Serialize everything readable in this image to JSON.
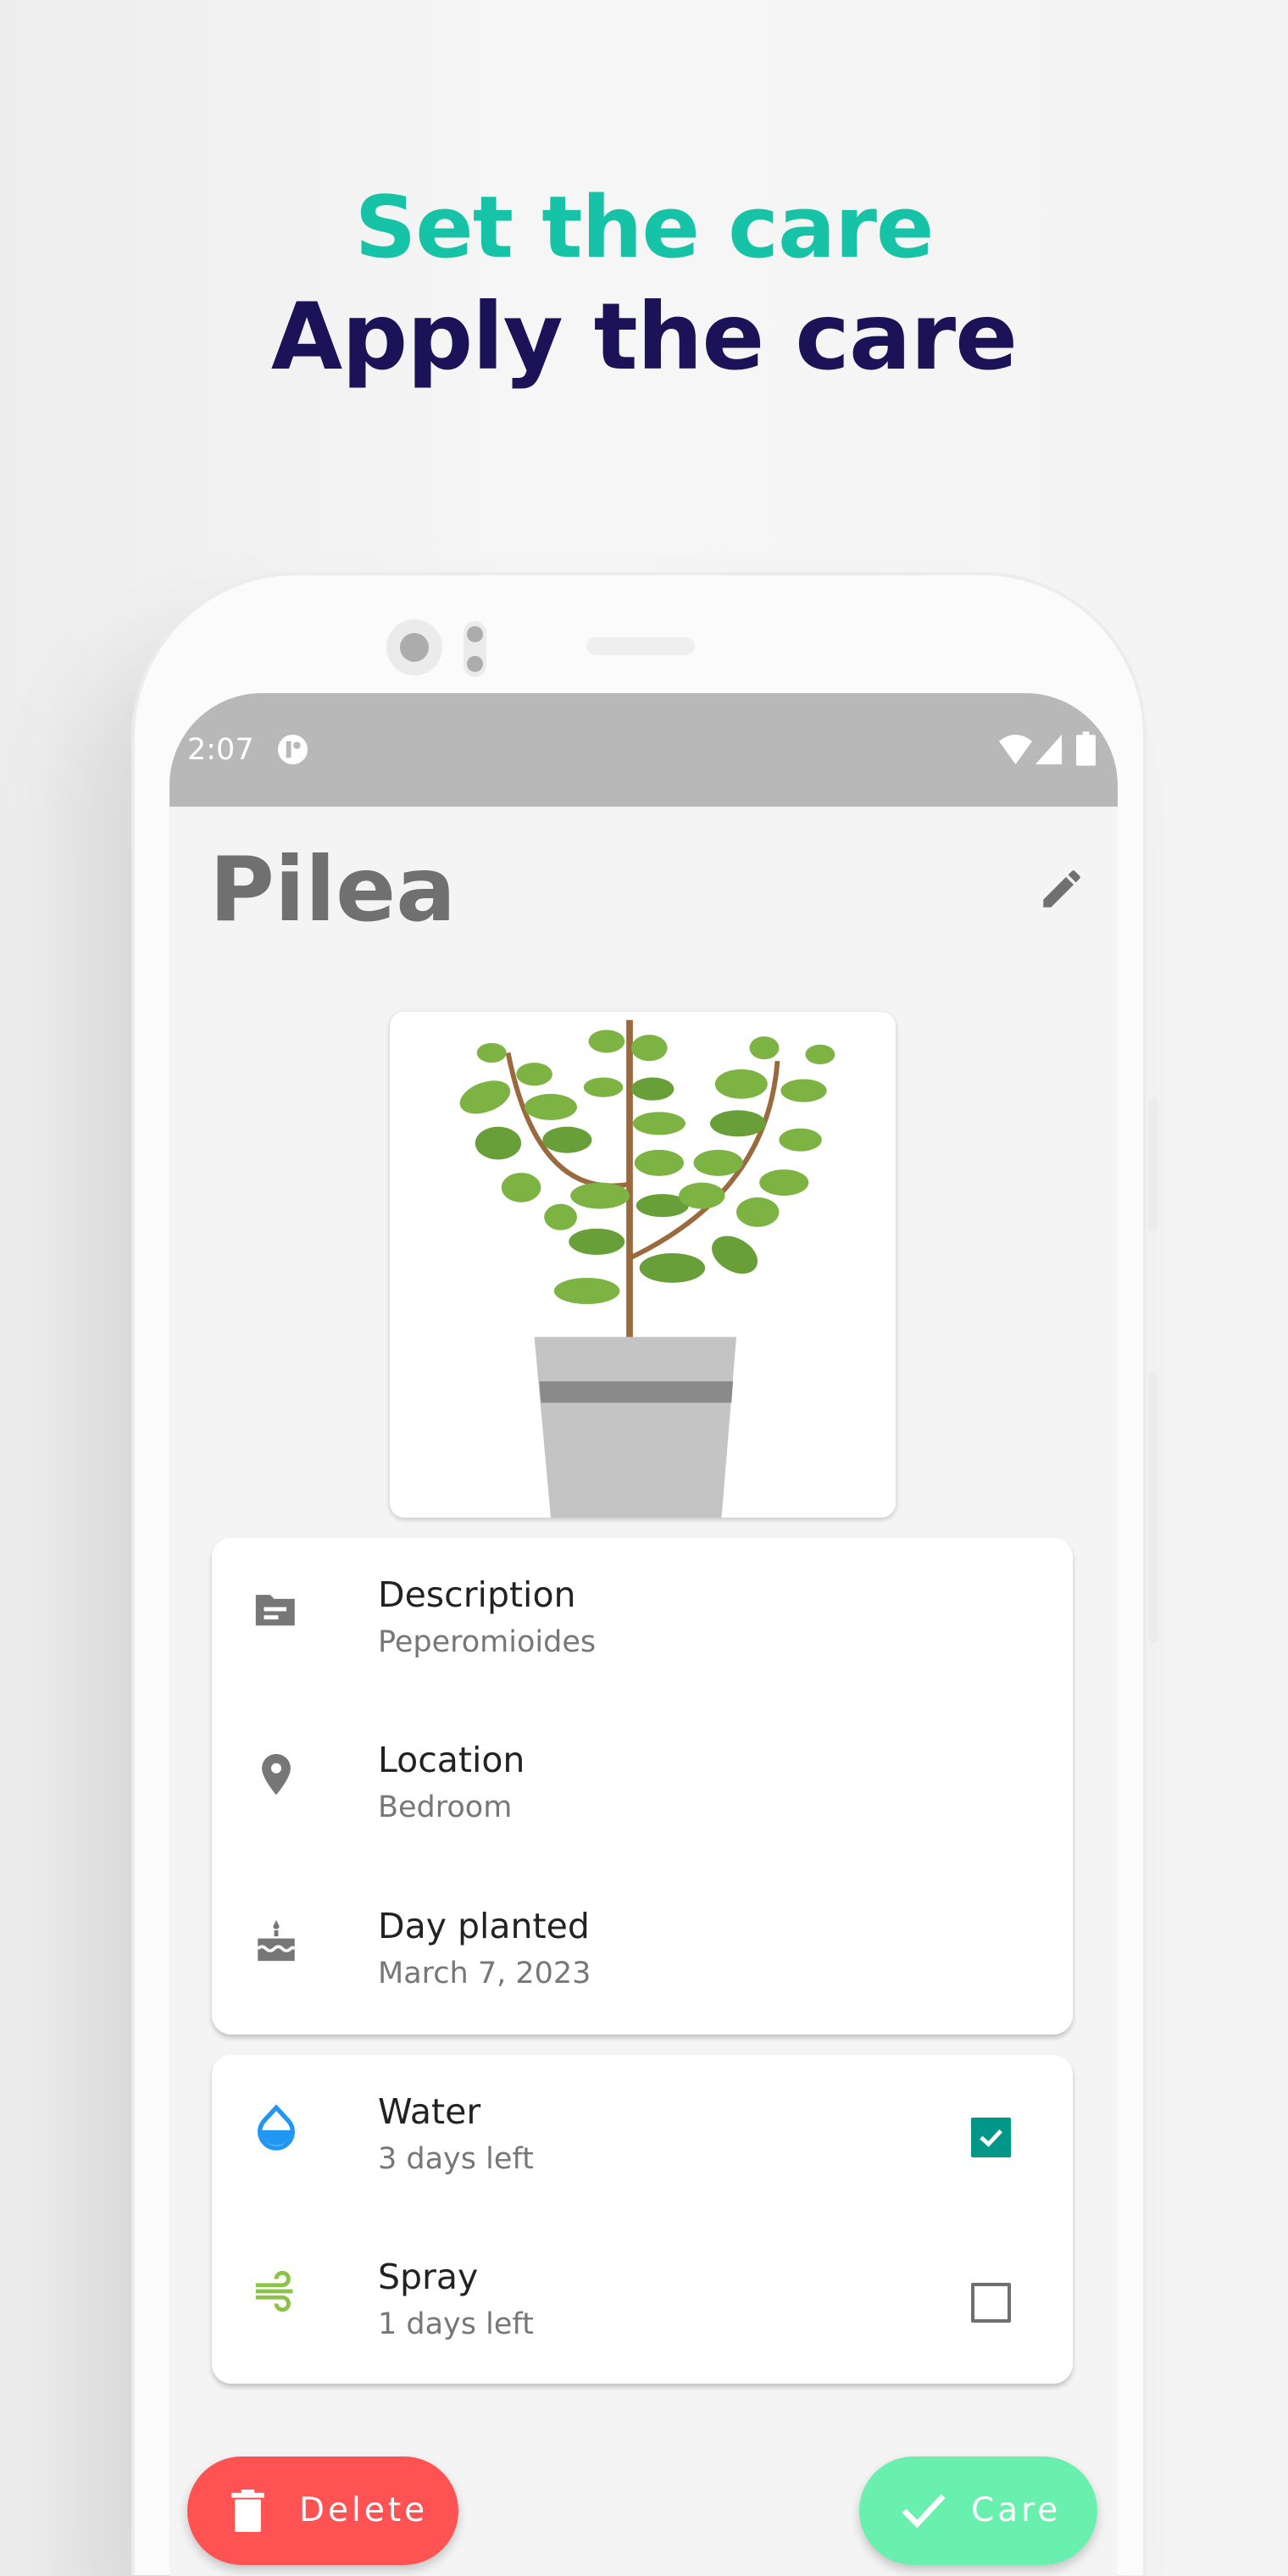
{
  "headline": {
    "line1": "Set the care",
    "line2": "Apply the care"
  },
  "status_bar": {
    "time": "2:07",
    "icons": [
      "notification-icon",
      "wifi-icon",
      "signal-icon",
      "battery-icon"
    ]
  },
  "plant": {
    "name": "Pilea",
    "edit_icon": "pencil-icon"
  },
  "info": [
    {
      "icon": "folder-icon",
      "label": "Description",
      "value": "Peperomioides"
    },
    {
      "icon": "location-pin-icon",
      "label": "Location",
      "value": "Bedroom"
    },
    {
      "icon": "cake-icon",
      "label": "Day planted",
      "value": "March 7, 2023"
    }
  ],
  "care": [
    {
      "icon": "water-drop-icon",
      "label": "Water",
      "value": "3 days left",
      "checked": true,
      "color": "#2196f3"
    },
    {
      "icon": "wind-icon",
      "label": "Spray",
      "value": "1 days left",
      "checked": false,
      "color": "#8bc34a"
    }
  ],
  "actions": {
    "delete": "Delete",
    "care": "Care",
    "delete_color": "#ff5252",
    "care_color": "#69f0ae"
  },
  "colors": {
    "headline1": "#17c3a6",
    "headline2": "#1b1257",
    "checkbox": "#009688"
  }
}
